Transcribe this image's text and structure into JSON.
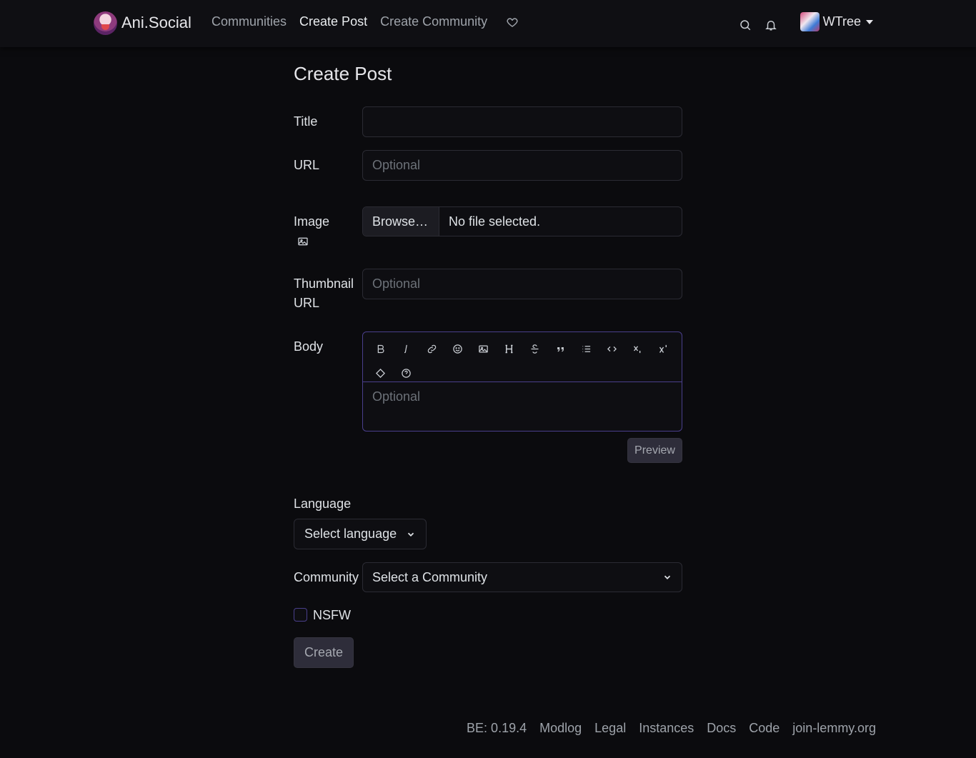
{
  "nav": {
    "brand": "Ani.Social",
    "links": [
      "Communities",
      "Create Post",
      "Create Community"
    ],
    "user": "WTree"
  },
  "page": {
    "title": "Create Post"
  },
  "form": {
    "title_label": "Title",
    "title_value": "",
    "url_label": "URL",
    "url_placeholder": "Optional",
    "image_label": "Image",
    "browse_label": "Browse…",
    "file_status": "No file selected.",
    "thumb_label_1": "Thumbnail",
    "thumb_label_2": "URL",
    "thumb_placeholder": "Optional",
    "body_label": "Body",
    "body_placeholder": "Optional",
    "preview_label": "Preview",
    "language_label": "Language",
    "language_value": "Select language",
    "community_label": "Community",
    "community_value": "Select a Community",
    "nsfw_label": "NSFW",
    "create_label": "Create"
  },
  "toolbar": {
    "row1": [
      "bold-icon",
      "italic-icon",
      "link-icon",
      "emoji-icon",
      "image-icon",
      "header-icon",
      "strikethrough-icon",
      "quote-icon",
      "list-icon",
      "code-icon",
      "subscript-icon",
      "superscript-icon"
    ],
    "row2": [
      "spoiler-icon",
      "help-icon"
    ]
  },
  "footer": {
    "version": "BE: 0.19.4",
    "links": [
      "Modlog",
      "Legal",
      "Instances",
      "Docs",
      "Code",
      "join-lemmy.org"
    ]
  }
}
